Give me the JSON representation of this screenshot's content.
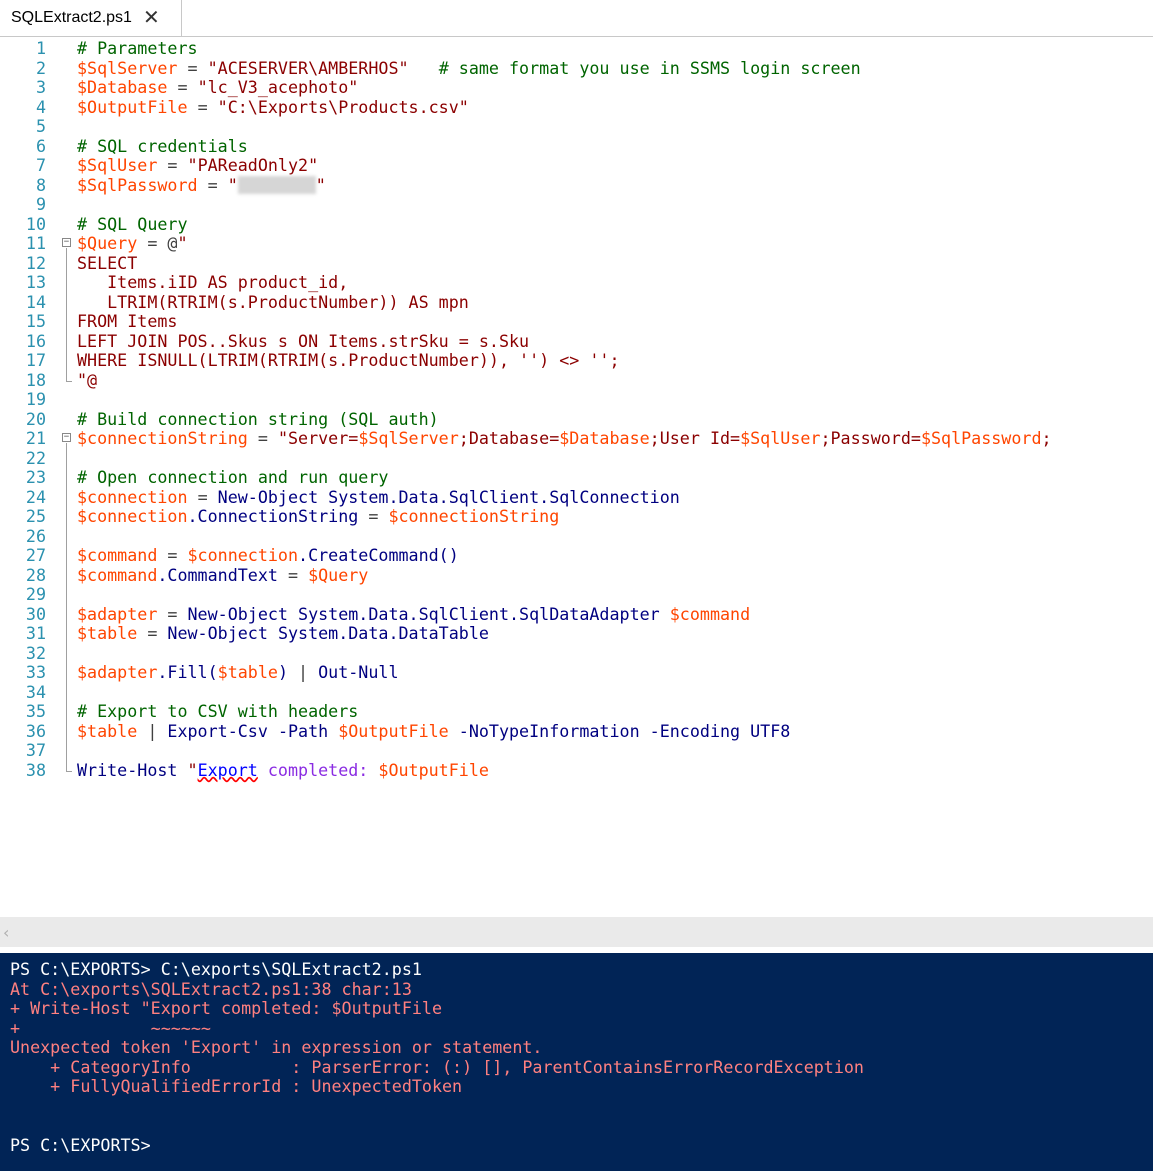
{
  "tab": {
    "title": "SQLExtract2.ps1",
    "close_glyph": "🗙"
  },
  "editor": {
    "lines": [
      {
        "n": "1",
        "t": "# Parameters"
      },
      {
        "n": "2",
        "t": "$SqlServer = \"ACESERVER\\AMBERHOS\"   # same format you use in SSMS login screen"
      },
      {
        "n": "3",
        "t": "$Database = \"lc_V3_acephoto\""
      },
      {
        "n": "4",
        "t": "$OutputFile = \"C:\\Exports\\Products.csv\""
      },
      {
        "n": "5",
        "t": ""
      },
      {
        "n": "6",
        "t": "# SQL credentials"
      },
      {
        "n": "7",
        "t": "$SqlUser = \"PAReadOnly2\""
      },
      {
        "n": "8",
        "t": "$SqlPassword = \"\""
      },
      {
        "n": "9",
        "t": ""
      },
      {
        "n": "10",
        "t": "# SQL Query"
      },
      {
        "n": "11",
        "t": "$Query = @\""
      },
      {
        "n": "12",
        "t": "SELECT"
      },
      {
        "n": "13",
        "t": "   Items.iID AS product_id,"
      },
      {
        "n": "14",
        "t": "   LTRIM(RTRIM(s.ProductNumber)) AS mpn"
      },
      {
        "n": "15",
        "t": "FROM Items"
      },
      {
        "n": "16",
        "t": "LEFT JOIN POS..Skus s ON Items.strSku = s.Sku"
      },
      {
        "n": "17",
        "t": "WHERE ISNULL(LTRIM(RTRIM(s.ProductNumber)), '') <> '';"
      },
      {
        "n": "18",
        "t": "\"@"
      },
      {
        "n": "19",
        "t": ""
      },
      {
        "n": "20",
        "t": "# Build connection string (SQL auth)"
      },
      {
        "n": "21",
        "t": "$connectionString = \"Server=$SqlServer;Database=$Database;User Id=$SqlUser;Password=$SqlPassword;"
      },
      {
        "n": "22",
        "t": ""
      },
      {
        "n": "23",
        "t": "# Open connection and run query"
      },
      {
        "n": "24",
        "t": "$connection = New-Object System.Data.SqlClient.SqlConnection"
      },
      {
        "n": "25",
        "t": "$connection.ConnectionString = $connectionString"
      },
      {
        "n": "26",
        "t": ""
      },
      {
        "n": "27",
        "t": "$command = $connection.CreateCommand()"
      },
      {
        "n": "28",
        "t": "$command.CommandText = $Query"
      },
      {
        "n": "29",
        "t": ""
      },
      {
        "n": "30",
        "t": "$adapter = New-Object System.Data.SqlClient.SqlDataAdapter $command"
      },
      {
        "n": "31",
        "t": "$table = New-Object System.Data.DataTable"
      },
      {
        "n": "32",
        "t": ""
      },
      {
        "n": "33",
        "t": "$adapter.Fill($table) | Out-Null"
      },
      {
        "n": "34",
        "t": ""
      },
      {
        "n": "35",
        "t": "# Export to CSV with headers"
      },
      {
        "n": "36",
        "t": "$table | Export-Csv -Path $OutputFile -NoTypeInformation -Encoding UTF8"
      },
      {
        "n": "37",
        "t": ""
      },
      {
        "n": "38",
        "t": "Write-Host \"Export completed: $OutputFile"
      }
    ]
  },
  "console": {
    "lines": [
      {
        "kind": "normal",
        "t": "PS C:\\EXPORTS> C:\\exports\\SQLExtract2.ps1"
      },
      {
        "kind": "error",
        "t": "At C:\\exports\\SQLExtract2.ps1:38 char:13"
      },
      {
        "kind": "error",
        "t": "+ Write-Host \"Export completed: $OutputFile"
      },
      {
        "kind": "error",
        "t": "+             ~~~~~~"
      },
      {
        "kind": "error",
        "t": "Unexpected token 'Export' in expression or statement."
      },
      {
        "kind": "error",
        "t": "    + CategoryInfo          : ParserError: (:) [], ParentContainsErrorRecordException"
      },
      {
        "kind": "error",
        "t": "    + FullyQualifiedErrorId : UnexpectedToken"
      },
      {
        "kind": "normal",
        "t": ""
      },
      {
        "kind": "normal",
        "t": ""
      },
      {
        "kind": "normal",
        "t": "PS C:\\EXPORTS>"
      }
    ]
  },
  "colors": {
    "comment": "#006400",
    "variable": "#ff4500",
    "string": "#8b0000",
    "operator": "#808080",
    "command": "#0000ff",
    "console_bg": "#012456",
    "console_error": "#ff8080",
    "line_number": "#2b91af"
  },
  "icons": {
    "close": "close-icon",
    "fold": "fold-collapse-icon",
    "scroll_left": "chevron-left-icon"
  }
}
